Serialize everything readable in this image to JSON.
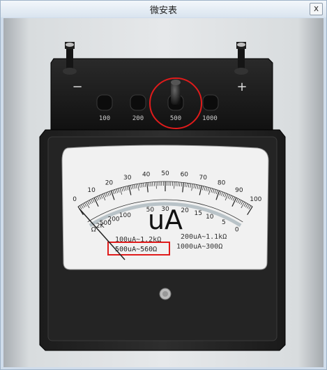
{
  "window": {
    "title": "微安表",
    "close_label": "x"
  },
  "terminals": {
    "minus": "−",
    "plus": "+"
  },
  "range_buttons": [
    {
      "label": "100",
      "selected": false
    },
    {
      "label": "200",
      "selected": false
    },
    {
      "label": "500",
      "selected": true
    },
    {
      "label": "1000",
      "selected": false
    }
  ],
  "scale": {
    "upper_ticks": [
      "0",
      "10",
      "20",
      "30",
      "40",
      "50",
      "60",
      "70",
      "80",
      "90",
      "100"
    ],
    "lower_ticks": [
      "Ω",
      "2K",
      "500",
      "200",
      "100",
      "50",
      "30",
      "20",
      "15",
      "10",
      "5",
      "0"
    ],
    "unit": "uA",
    "resistance_notes": [
      {
        "text": "100uA~1.2kΩ",
        "selected": false
      },
      {
        "text": "500uA~560Ω",
        "selected": true
      },
      {
        "text": "200uA~1.1kΩ",
        "selected": false
      },
      {
        "text": "1000uA~300Ω",
        "selected": false
      }
    ]
  },
  "needle": {
    "reading": 0
  },
  "colors": {
    "highlight": "#e01b1b",
    "panel": "#1a1a1a",
    "dial": "#f1f1f1"
  }
}
